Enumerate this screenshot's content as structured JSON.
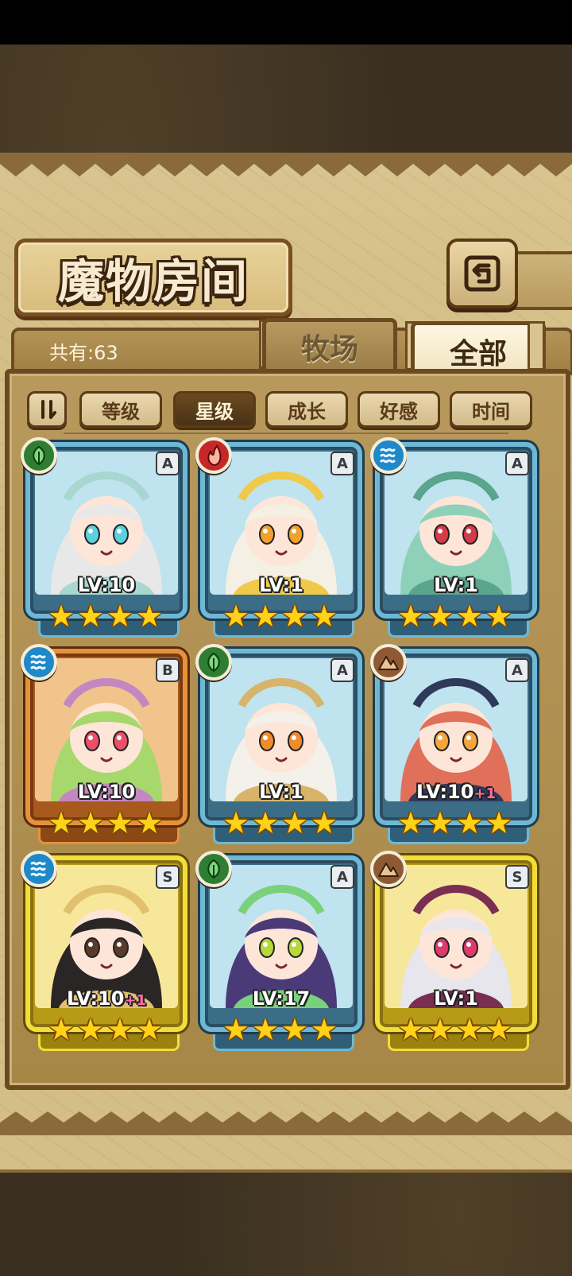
{
  "title": "魔物房间",
  "count_label": "共有:63",
  "tabs": {
    "ranch": "牧场",
    "all": "全部"
  },
  "sort": {
    "toggle_icon": "sort-order-icon",
    "options": [
      "等级",
      "星级",
      "成长",
      "好感",
      "时间"
    ],
    "active": "星级"
  },
  "colors": {
    "frame_A": "#6fb8d4",
    "frame_B": "#e5923e",
    "frame_S": "#f3dd3a",
    "grass": "#2e7d32",
    "fire": "#c62828",
    "water": "#1e88c9",
    "earth": "#8d5a34"
  },
  "monsters": [
    {
      "rarity": "A",
      "element": "grass",
      "level": "LV:10",
      "plus": "",
      "stars": 4
    },
    {
      "rarity": "A",
      "element": "fire",
      "level": "LV:1",
      "plus": "",
      "stars": 4
    },
    {
      "rarity": "A",
      "element": "water",
      "level": "LV:1",
      "plus": "",
      "stars": 4
    },
    {
      "rarity": "B",
      "element": "water",
      "level": "LV:10",
      "plus": "",
      "stars": 4
    },
    {
      "rarity": "A",
      "element": "grass",
      "level": "LV:1",
      "plus": "",
      "stars": 4
    },
    {
      "rarity": "A",
      "element": "earth",
      "level": "LV:10",
      "plus": "+1",
      "stars": 4
    },
    {
      "rarity": "S",
      "element": "water",
      "level": "LV:10",
      "plus": "+1",
      "stars": 4
    },
    {
      "rarity": "A",
      "element": "grass",
      "level": "LV:17",
      "plus": "",
      "stars": 4
    },
    {
      "rarity": "S",
      "element": "earth",
      "level": "LV:1",
      "plus": "",
      "stars": 4
    }
  ]
}
